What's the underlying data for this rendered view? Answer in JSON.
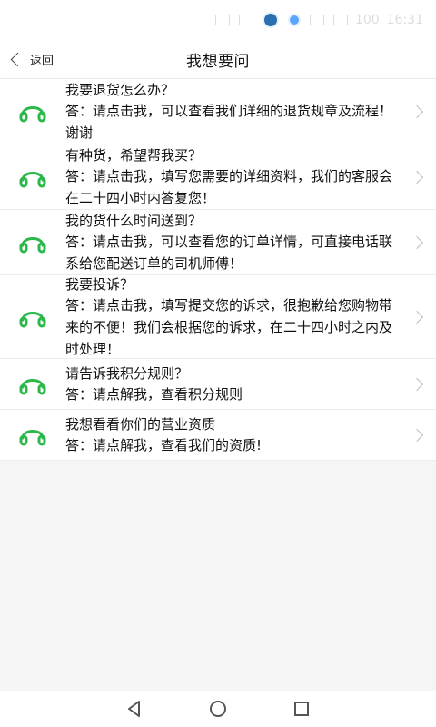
{
  "status": {
    "time": "16:31",
    "battery": "100"
  },
  "header": {
    "back_label": "返回",
    "title": "我想要问"
  },
  "faq": [
    {
      "q": "我要退货怎么办？",
      "a": "答：请点击我，可以查看我们详细的退货规章及流程！谢谢"
    },
    {
      "q": "有种货，希望帮我买？",
      "a": "答：请点击我，填写您需要的详细资料，我们的客服会在二十四小时内答复您！"
    },
    {
      "q": "我的货什么时间送到？",
      "a": "答：请点击我，可以查看您的订单详情，可直接电话联系给您配送订单的司机师傅！"
    },
    {
      "q": "我要投诉？",
      "a": "答：请点击我，填写提交您的诉求，很抱歉给您购物带来的不便！我们会根据您的诉求，在二十四小时之内及时处理！"
    },
    {
      "q": "请告诉我积分规则？",
      "a": "答：请点解我，查看积分规则"
    },
    {
      "q": "我想看看你们的营业资质",
      "a": "答：请点解我，查看我们的资质!"
    }
  ],
  "colors": {
    "accent_green": "#2bb84a",
    "divider": "#ededed",
    "bg": "#f5f5f5"
  },
  "icons": {
    "faq_icon": "headset-icon",
    "row_arrow": "chevron-right-icon",
    "back": "chevron-left-icon"
  }
}
